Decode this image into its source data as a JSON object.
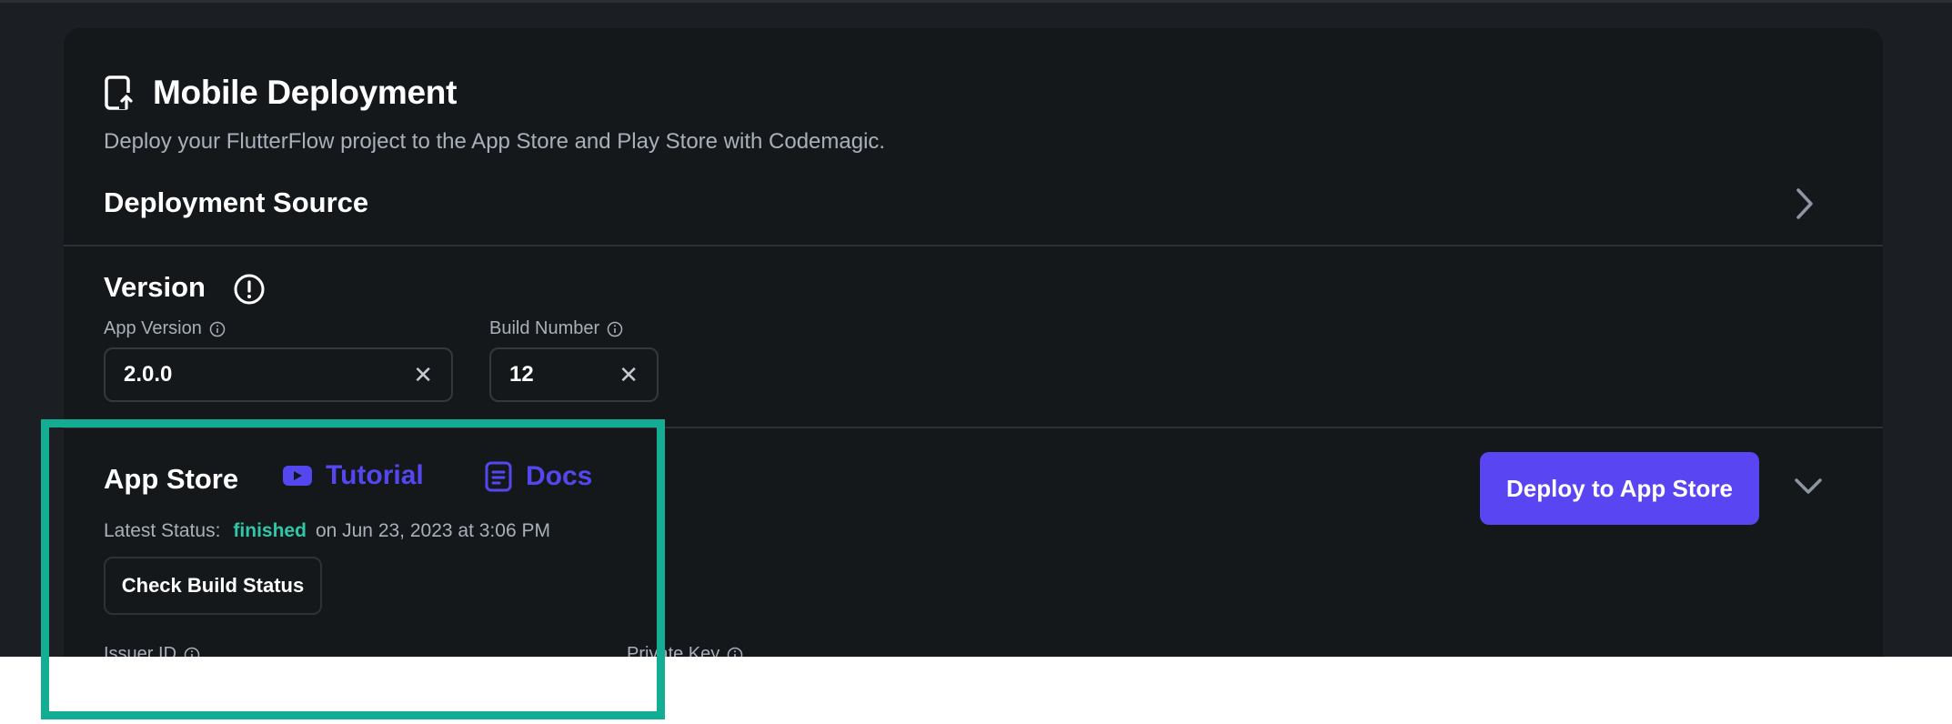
{
  "header": {
    "title": "Mobile Deployment",
    "subtitle": "Deploy your FlutterFlow project to the App Store and Play Store with Codemagic."
  },
  "deployment_source": {
    "title": "Deployment Source"
  },
  "version": {
    "title": "Version",
    "app_version": {
      "label": "App Version",
      "value": "2.0.0"
    },
    "build_number": {
      "label": "Build Number",
      "value": "12"
    }
  },
  "app_store": {
    "title": "App Store",
    "tutorial_label": "Tutorial",
    "docs_label": "Docs",
    "status_prefix": "Latest Status:",
    "status_value": "finished",
    "status_date": "on Jun 23, 2023 at 3:06 PM",
    "check_button": "Check Build Status",
    "deploy_button": "Deploy to App Store",
    "issuer_id_label": "Issuer ID",
    "private_key_label": "Private Key"
  },
  "colors": {
    "accent": "#5a45f2",
    "status_success": "#2fc7a7",
    "highlight": "#13ad94",
    "panel": "#14181b"
  },
  "icons": [
    "mobile-upload-icon",
    "chevron-right-icon",
    "alert-circle-icon",
    "info-icon",
    "close-icon",
    "youtube-icon",
    "document-icon",
    "chevron-down-icon"
  ]
}
